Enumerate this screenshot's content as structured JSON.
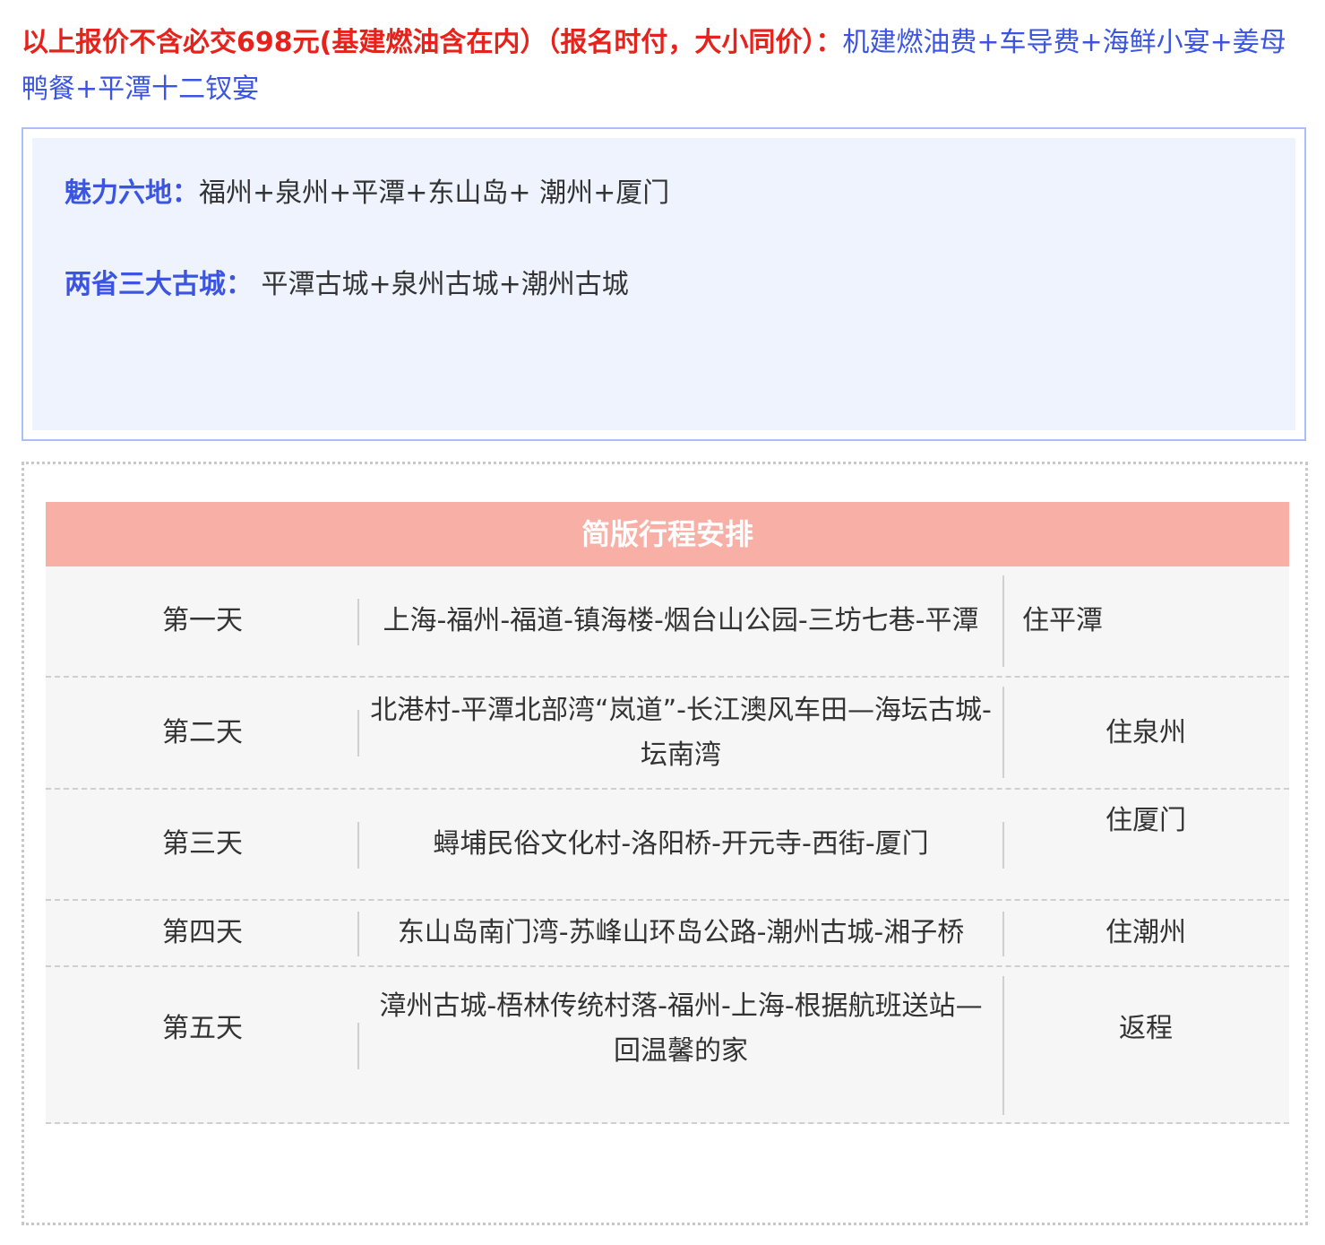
{
  "notice": {
    "red_text": "以上报价不含必交698元(基建燃油含在内）（报名时付，大小同价）：",
    "blue_text": "机建燃油费+车导费+海鲜小宴+姜母鸭餐+平潭十二钗宴"
  },
  "highlights": [
    {
      "label": "魅力六地：",
      "value": "福州+泉州+平潭+东山岛+ 潮州+厦门"
    },
    {
      "label": "两省三大古城：",
      "value": " 平潭古城+泉州古城+潮州古城"
    }
  ],
  "schedule": {
    "title": "简版行程安排",
    "rows": [
      {
        "day": "第一天",
        "route": "上海-福州-福道-镇海楼-烟台山公园-三坊七巷-平潭",
        "stay": "住平潭"
      },
      {
        "day": "第二天",
        "route": "北港村-平潭北部湾“岚道”-长江澳风车田—海坛古城-坛南湾",
        "stay": "住泉州"
      },
      {
        "day": "第三天",
        "route": "蟳埔民俗文化村-洛阳桥-开元寺-西街-厦门",
        "stay": "住厦门"
      },
      {
        "day": "第四天",
        "route": "东山岛南门湾-苏峰山环岛公路-潮州古城-湘子桥",
        "stay": "住潮州"
      },
      {
        "day": "第五天",
        "route": "漳州古城-梧林传统村落-福州-上海-根据航班送站—回温馨的家",
        "stay": "返程"
      }
    ]
  }
}
